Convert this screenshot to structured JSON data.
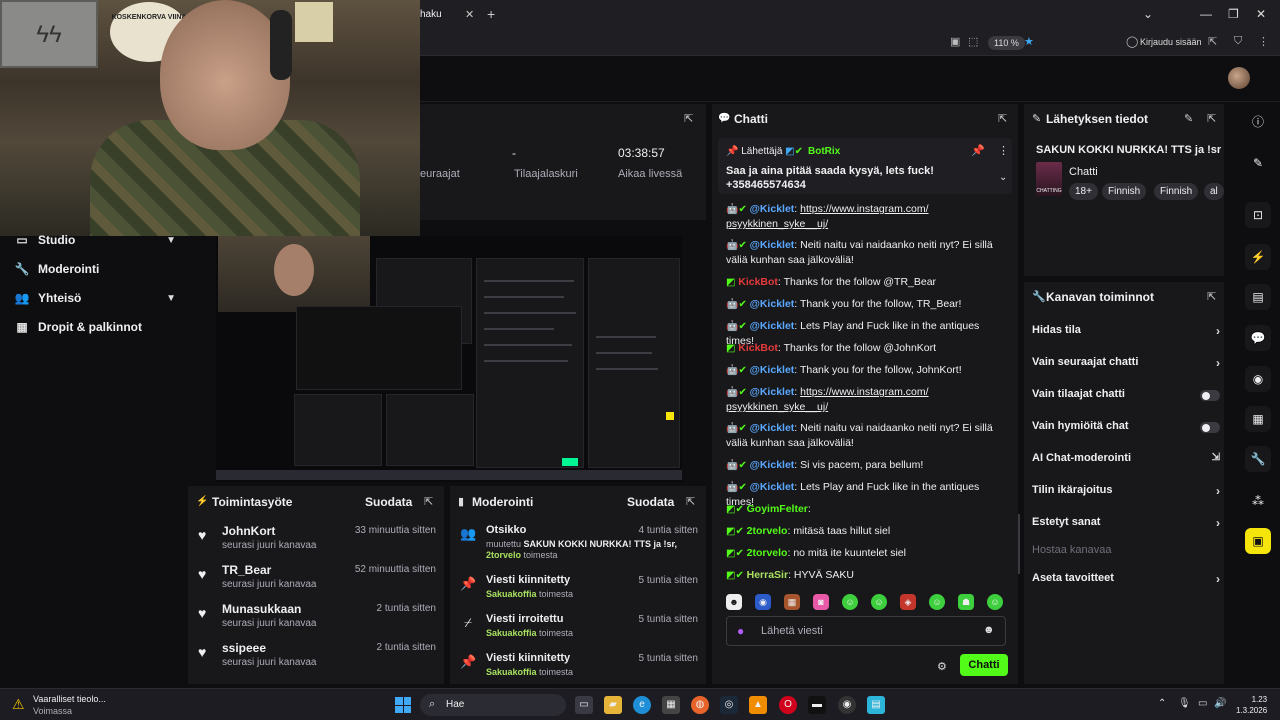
{
  "browser": {
    "tab_title": "haku",
    "zoom": "110 %",
    "login": "Kirjaudu sisään"
  },
  "webcam": {
    "poster_text": "KOSKENKORVA VIINA"
  },
  "stats": {
    "item1_label": "euraajat",
    "item2_value": "-",
    "item2_label": "Tilaajalaskuri",
    "item3_value": "03:38:57",
    "item3_label": "Aikaa livessä"
  },
  "nav": {
    "items": [
      {
        "label": "Studio",
        "icon": "studio-icon"
      },
      {
        "label": "Moderointi",
        "icon": "wrench-icon"
      },
      {
        "label": "Yhteisö",
        "icon": "people-icon"
      },
      {
        "label": "Dropit & palkinnot",
        "icon": "gift-icon"
      }
    ]
  },
  "activity": {
    "title": "Toimintasyöte",
    "filter": "Suodata",
    "items": [
      {
        "name": "JohnKort",
        "sub": "seurasi juuri kanavaa",
        "time": "33 minuuttia sitten"
      },
      {
        "name": "TR_Bear",
        "sub": "seurasi juuri kanavaa",
        "time": "52 minuuttia sitten"
      },
      {
        "name": "Munasukkaan",
        "sub": "seurasi juuri kanavaa",
        "time": "2 tuntia sitten"
      },
      {
        "name": "ssipeee",
        "sub": "seurasi juuri kanavaa",
        "time": "2 tuntia sitten"
      }
    ]
  },
  "moderation": {
    "title": "Moderointi",
    "filter": "Suodata",
    "items": [
      {
        "name": "Otsikko",
        "time": "4 tuntia sitten",
        "pre": "muutettu",
        "subject": "SAKUN KOKKI NURKKA! TTS ja !sr,",
        "actor": "2torvelo",
        "post": "toimesta"
      },
      {
        "name": "Viesti kiinnitetty",
        "time": "5 tuntia sitten",
        "actor": "Sakuakoffia",
        "post": "toimesta"
      },
      {
        "name": "Viesti irroitettu",
        "time": "5 tuntia sitten",
        "actor": "Sakuakoffia",
        "post": "toimesta"
      },
      {
        "name": "Viesti kiinnitetty",
        "time": "5 tuntia sitten",
        "actor": "Sakuakoffia",
        "post": "toimesta"
      }
    ]
  },
  "chat": {
    "title": "Chatti",
    "pinned_by": "Lähettäjä",
    "pinned_user": "BotRix",
    "pinned_message": "Saa ja aina pitää saada kysyä, lets fuck! +358465574634",
    "messages": [
      {
        "user": "@Kicklet",
        "color": "#5aa9ff",
        "text": "https://www.instagram.com/ psyykkinen_syke__uj/",
        "link": true
      },
      {
        "user": "@Kicklet",
        "color": "#5aa9ff",
        "text": "Neiti naitu vai naidaanko neiti nyt? Ei sillä väliä kunhan saa jälkoväliä!"
      },
      {
        "user": "KickBot",
        "color": "#e63a3a",
        "text": "Thanks for the follow @TR_Bear"
      },
      {
        "user": "@Kicklet",
        "color": "#5aa9ff",
        "text": "Thank you for the follow, TR_Bear!"
      },
      {
        "user": "@Kicklet",
        "color": "#5aa9ff",
        "text": "Lets Play and Fuck like in the antiques times!"
      },
      {
        "user": "KickBot",
        "color": "#e63a3a",
        "text": "Thanks for the follow @JohnKort"
      },
      {
        "user": "@Kicklet",
        "color": "#5aa9ff",
        "text": "Thank you for the follow, JohnKort!"
      },
      {
        "user": "@Kicklet",
        "color": "#5aa9ff",
        "text": "https://www.instagram.com/ psyykkinen_syke__uj/",
        "link": true
      },
      {
        "user": "@Kicklet",
        "color": "#5aa9ff",
        "text": "Neiti naitu vai naidaanko neiti nyt? Ei sillä väliä kunhan saa jälkoväliä!"
      },
      {
        "user": "@Kicklet",
        "color": "#5aa9ff",
        "text": "Si vis pacem, para bellum!"
      },
      {
        "user": "@Kicklet",
        "color": "#5aa9ff",
        "text": "Lets Play and Fuck like in the antiques times!"
      },
      {
        "user": "GoyimFelter",
        "color": "#53fc18",
        "text": ""
      },
      {
        "user": "2torvelo",
        "color": "#53fc18",
        "text": "mitäsä taas hillut siel"
      },
      {
        "user": "2torvelo",
        "color": "#53fc18",
        "text": "no mitä ite kuuntelet siel"
      },
      {
        "user": "HerraSir",
        "color": "#a8e05f",
        "text": "HYVÄ SAKU"
      }
    ],
    "input_placeholder": "Lähetä viesti",
    "send_label": "Chatti"
  },
  "stream_info": {
    "title": "Lähetyksen tiedot",
    "stream_title": "SAKUN KOKKI NURKKA! TTS ja !sr",
    "category": "Chatti",
    "thumb_text": "CHATTING",
    "tags": [
      "18+",
      "Finnish",
      "Finnish",
      "al"
    ]
  },
  "channel_actions": {
    "title": "Kanavan toiminnot",
    "items": [
      {
        "label": "Hidas tila",
        "kind": "chevron"
      },
      {
        "label": "Vain seuraajat chatti",
        "kind": "chevron"
      },
      {
        "label": "Vain tilaajat chatti",
        "kind": "toggle"
      },
      {
        "label": "Vain hymiöitä chat",
        "kind": "toggle"
      },
      {
        "label": "AI Chat-moderointi",
        "kind": "external"
      },
      {
        "label": "Tilin ikärajoitus",
        "kind": "chevron"
      },
      {
        "label": "Estetyt sanat",
        "kind": "chevron"
      },
      {
        "label": "Hostaa kanavaa",
        "kind": "disabled"
      },
      {
        "label": "Aseta tavoitteet",
        "kind": "chevron"
      }
    ]
  },
  "taskbar": {
    "warning_title": "Vaaralliset tieolo...",
    "warning_sub": "Voimassa",
    "search": "Hae",
    "time": "1.23",
    "date": "1.3.2026"
  },
  "colors": {
    "accent": "#53fc18",
    "bg": "#0e0e10",
    "panel": "#18181b"
  }
}
